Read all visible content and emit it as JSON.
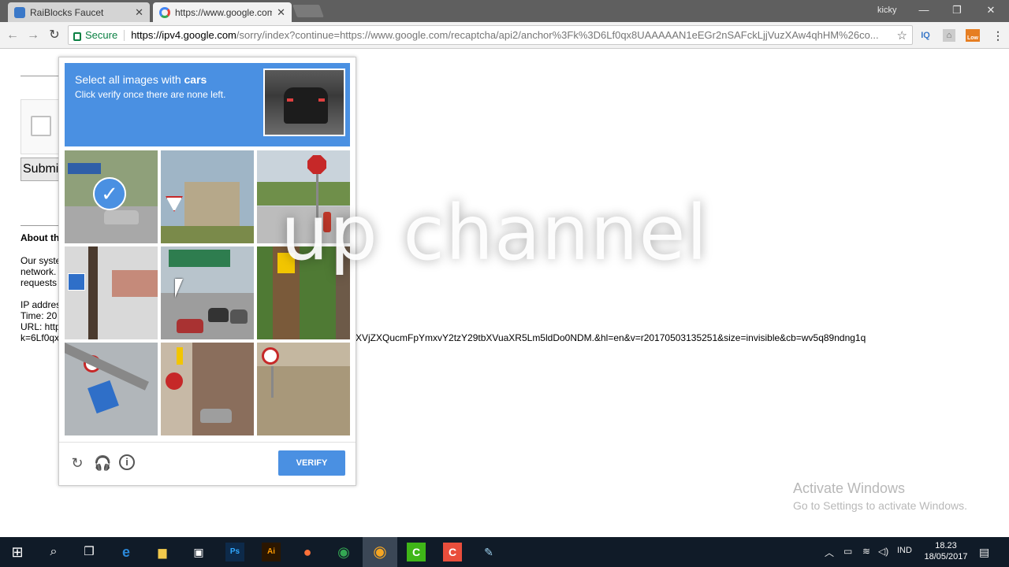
{
  "browser": {
    "tabs": [
      {
        "title": "RaiBlocks Faucet"
      },
      {
        "title": "https://www.google.com"
      }
    ],
    "user": "kicky",
    "omnibox": {
      "secure_label": "Secure",
      "url_host": "https://ipv4.google.com",
      "url_rest": "/sorry/index?continue=https://www.google.com/recaptcha/api2/anchor%3Fk%3D6Lf0qx8UAAAAAN1eEGr2nSAFckLjjVuzXAw4qhHM%26co..."
    },
    "extensions": [
      "IQ",
      "Low"
    ]
  },
  "page": {
    "submit_label": "Submi",
    "about_heading": "About th",
    "info_lines": [
      "Our syste",
      "network.",
      "requests",
      "",
      "IP addres",
      "Time: 20",
      "URL: http",
      "k=6Lf0qx"
    ],
    "url_tail": "XVjZXQucmFpYmxvY2tzY29tbXVuaXR5Lm5ldDo0NDM.&hl=en&v=r20170503135251&size=invisible&cb=wv5q89ndng1q",
    "watermark": "up channel"
  },
  "captcha": {
    "instruction_prefix": "Select all images with ",
    "instruction_target": "cars",
    "instruction_sub": "Click verify once there are none left.",
    "verify_label": "VERIFY",
    "footer_icons": [
      "reload-icon",
      "audio-icon",
      "info-icon"
    ],
    "selected_tiles": [
      0
    ],
    "accent_color": "#4a90e2"
  },
  "windows": {
    "activate_title": "Activate Windows",
    "activate_sub": "Go to Settings to activate Windows.",
    "language": "IND",
    "time": "18.23",
    "date": "18/05/2017"
  }
}
